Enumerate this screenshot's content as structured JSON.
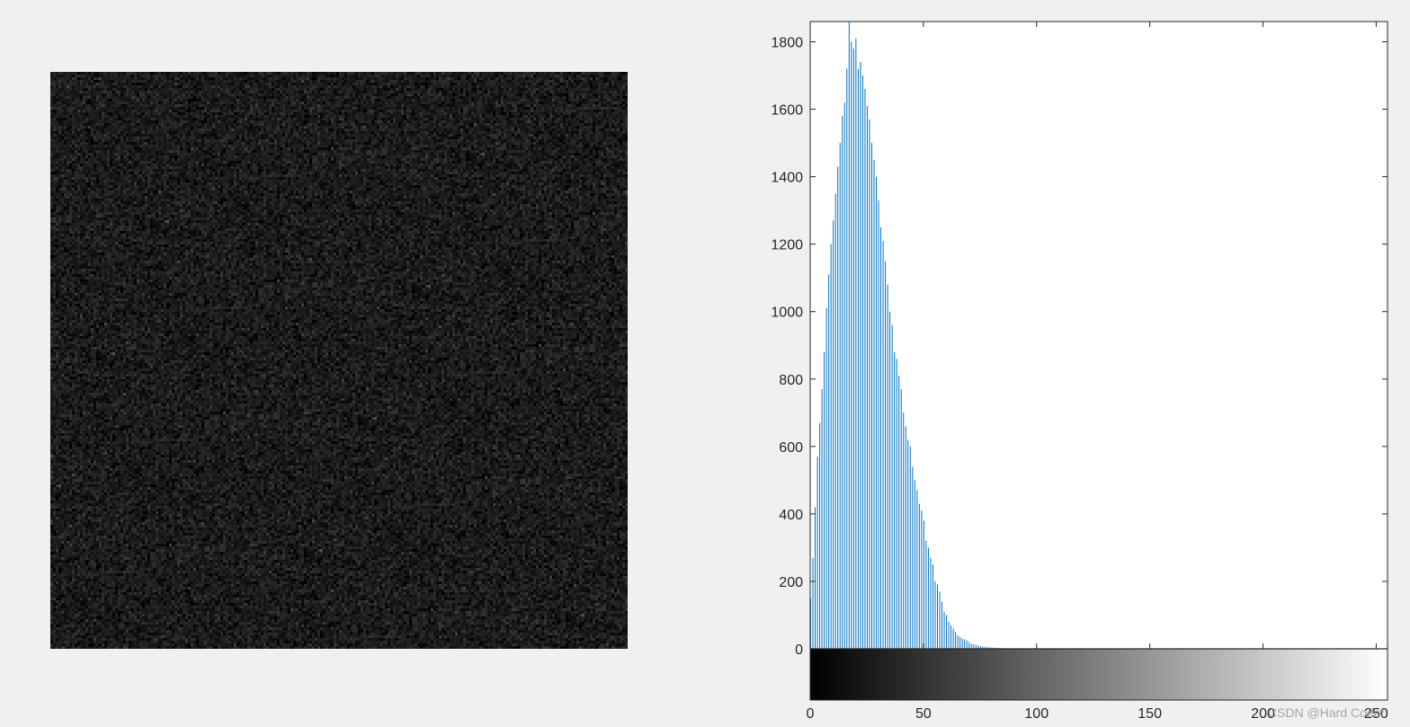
{
  "figure": {
    "background_color": "#f0f0f0",
    "watermark": "CSDN @Hard Coder"
  },
  "image_panel": {
    "description_type": "grayscale-noise-image",
    "mean_gray_level": 27,
    "spread": 13
  },
  "chart_data": {
    "type": "bar",
    "title": "",
    "xlabel": "",
    "ylabel": "",
    "xlim": [
      0,
      255
    ],
    "ylim": [
      -150,
      1860
    ],
    "bar_color": "#0072bd",
    "grid": false,
    "colorbar": {
      "type": "grayscale-gradient",
      "from": "#000000",
      "to": "#ffffff"
    },
    "x_ticks": [
      0,
      50,
      100,
      150,
      200,
      250
    ],
    "y_ticks": [
      0,
      200,
      400,
      600,
      800,
      1000,
      1200,
      1400,
      1600,
      1800
    ],
    "bins": [
      0,
      1,
      2,
      3,
      4,
      5,
      6,
      7,
      8,
      9,
      10,
      11,
      12,
      13,
      14,
      15,
      16,
      17,
      18,
      19,
      20,
      21,
      22,
      23,
      24,
      25,
      26,
      27,
      28,
      29,
      30,
      31,
      32,
      33,
      34,
      35,
      36,
      37,
      38,
      39,
      40,
      41,
      42,
      43,
      44,
      45,
      46,
      47,
      48,
      49,
      50,
      51,
      52,
      53,
      54,
      55,
      56,
      57,
      58,
      59,
      60,
      61,
      62,
      63,
      64,
      65,
      66,
      67,
      68,
      69,
      70,
      71,
      72,
      73,
      74,
      75,
      76,
      77,
      78,
      79,
      80,
      81,
      82,
      83,
      84,
      85,
      86,
      87,
      88,
      89,
      90,
      91,
      92,
      93,
      94,
      95
    ],
    "values": [
      150,
      270,
      420,
      570,
      670,
      770,
      880,
      1010,
      1110,
      1200,
      1270,
      1350,
      1430,
      1500,
      1580,
      1620,
      1720,
      1860,
      1800,
      1780,
      1810,
      1720,
      1740,
      1700,
      1660,
      1610,
      1570,
      1500,
      1450,
      1400,
      1330,
      1250,
      1210,
      1150,
      1080,
      1000,
      960,
      880,
      860,
      810,
      770,
      700,
      660,
      620,
      600,
      540,
      500,
      470,
      430,
      410,
      380,
      320,
      300,
      270,
      250,
      200,
      190,
      170,
      140,
      110,
      100,
      80,
      70,
      60,
      50,
      40,
      35,
      30,
      28,
      25,
      20,
      15,
      14,
      12,
      10,
      8,
      7,
      6,
      5,
      4,
      4,
      3,
      3,
      2,
      2,
      2,
      1,
      1,
      1,
      1,
      1,
      1,
      1,
      0,
      0,
      0
    ]
  }
}
